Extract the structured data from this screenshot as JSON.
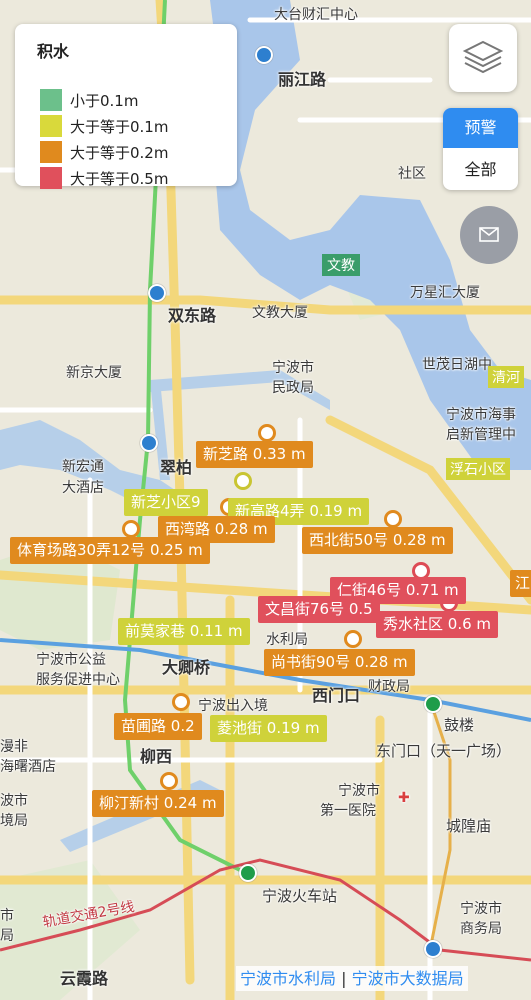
{
  "legend": {
    "title": "积水",
    "items": [
      {
        "label": "小于0.1m",
        "color": "#6cc08b"
      },
      {
        "label": "大于等于0.1m",
        "color": "#d9d93b"
      },
      {
        "label": "大于等于0.2m",
        "color": "#e08a1e"
      },
      {
        "label": "大于等于0.5m",
        "color": "#e0505c"
      }
    ]
  },
  "controls": {
    "layers_icon": "layers-icon",
    "warn_label": "预警",
    "all_label": "全部",
    "message_icon": "envelope-icon"
  },
  "map_labels": {
    "dahuacai": "大台财汇中心",
    "lijiang": "丽江路",
    "shequ": "社区",
    "wenjiao_road": "文教",
    "wanxing": "万星汇大厦",
    "shuangdong": "双东路",
    "wenjiao_tower": "文教大厦",
    "xinjing": "新京大厦",
    "minzheng1": "宁波市",
    "minzheng2": "民政局",
    "shimao": "世茂日湖中",
    "qinghe": "清河",
    "haishi1": "宁波市海事",
    "haishi2": "启新管理中",
    "fushi": "浮石小区",
    "xinhong1": "新宏通",
    "xinhong2": "大酒店",
    "cuibai": "翠柏",
    "gongyi1": "宁波市公益",
    "gongyi2": "服务促进中心",
    "daliqiao": "大卿桥",
    "shuiliju": "水利局",
    "xikou": "西门口",
    "caizheng": "财政局",
    "crj": "宁波出入境",
    "gulou": "鼓楼",
    "dongmenkou": "东门口（天一广场）",
    "liuxi": "柳西",
    "manfei": "漫非",
    "hailu": "海曙酒店",
    "bolu1": "波市",
    "bolu2": "境局",
    "yiyuan1": "宁波市",
    "yiyuan2": "第一医院",
    "chenghuang": "城隍庙",
    "station": "宁波火车站",
    "shangwu1": "宁波市",
    "shangwu2": "商务局",
    "metro2": "轨道交通2号线",
    "yunxia": "云霞路",
    "shi": "市",
    "ju": "局",
    "river": "江"
  },
  "flood_points": [
    {
      "name": "新芝路",
      "depth": "0.33 m",
      "level": "orange"
    },
    {
      "name": "新芝小区9",
      "depth": "",
      "level": "yellow"
    },
    {
      "name": "新高路4弄",
      "depth": "0.19 m",
      "level": "yellow"
    },
    {
      "name": "西湾路",
      "depth": "0.28 m",
      "level": "orange"
    },
    {
      "name": "体育场路30弄12号",
      "depth": "0.25 m",
      "level": "orange"
    },
    {
      "name": "西北街50号",
      "depth": "0.28 m",
      "level": "orange"
    },
    {
      "name": "仁街46号",
      "depth": "0.71 m",
      "level": "red"
    },
    {
      "name": "文昌街76号",
      "depth": "0.5",
      "level": "red"
    },
    {
      "name": "秀水社区",
      "depth": "0.6 m",
      "level": "red"
    },
    {
      "name": "前莫家巷",
      "depth": "0.11 m",
      "level": "yellow"
    },
    {
      "name": "尚书街90号",
      "depth": "0.28 m",
      "level": "orange"
    },
    {
      "name": "苗圃路",
      "depth": "0.2",
      "level": "orange"
    },
    {
      "name": "菱池街",
      "depth": "0.19 m",
      "level": "yellow"
    },
    {
      "name": "柳汀新村",
      "depth": "0.24 m",
      "level": "orange"
    },
    {
      "name": "江",
      "depth": "",
      "level": "orange"
    }
  ],
  "credits": {
    "left": "宁波市水利局",
    "sep": "|",
    "right": "宁波市大数据局"
  }
}
